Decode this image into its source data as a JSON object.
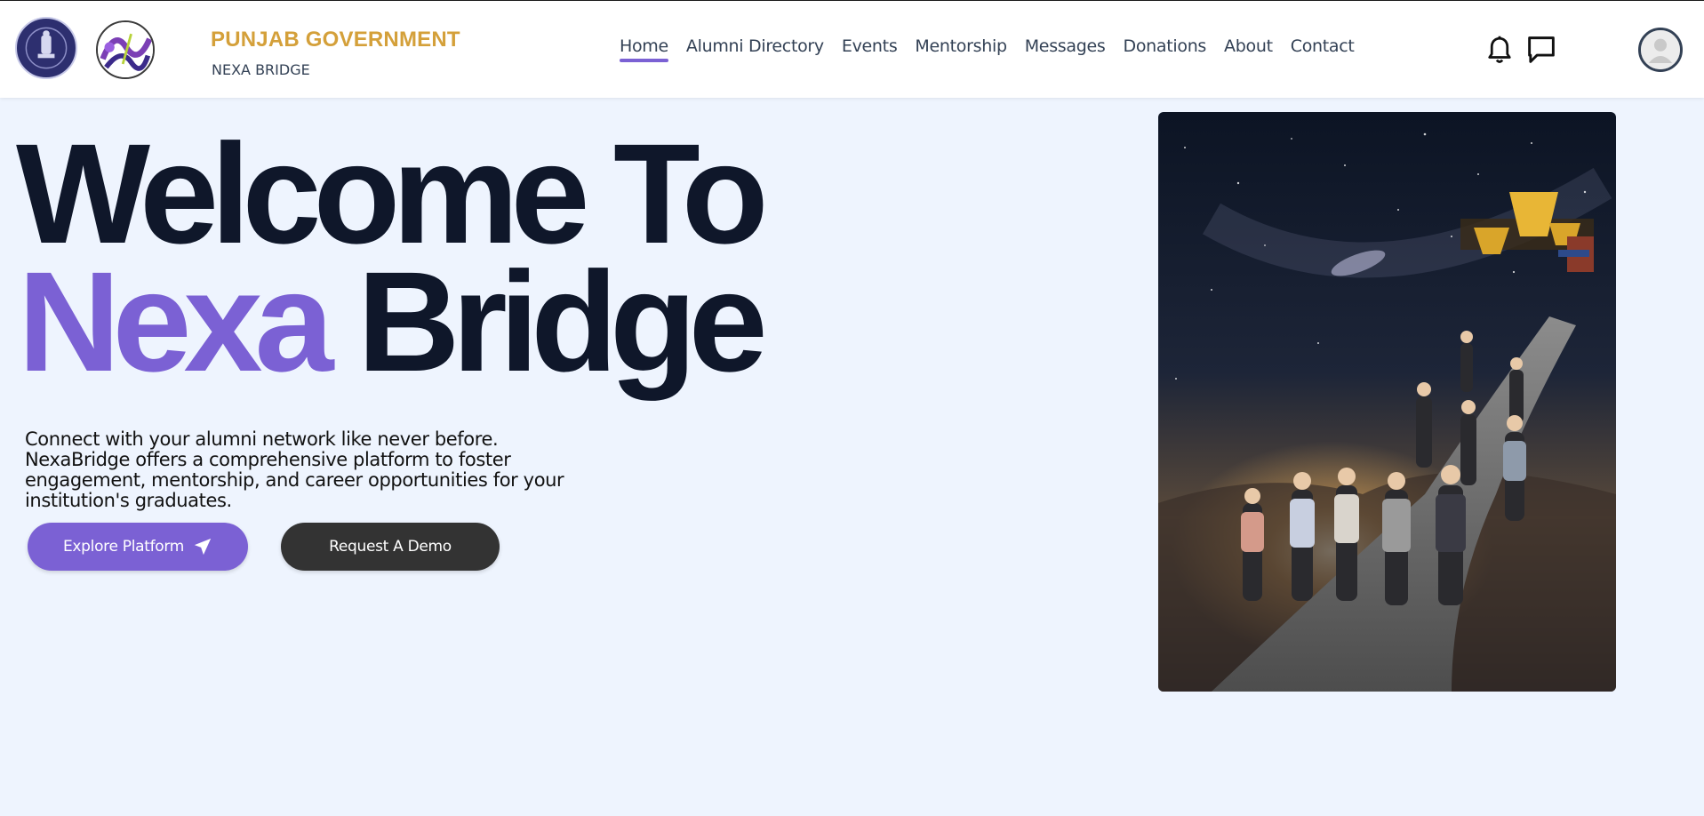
{
  "brand": {
    "title": "PUNJAB GOVERNMENT",
    "subtitle": "NEXA BRIDGE",
    "logos": [
      "emblem-logo",
      "nexa-logo"
    ]
  },
  "nav": {
    "items": [
      {
        "label": "Home",
        "active": true
      },
      {
        "label": "Alumni Directory",
        "active": false
      },
      {
        "label": "Events",
        "active": false
      },
      {
        "label": "Mentorship",
        "active": false
      },
      {
        "label": "Messages",
        "active": false
      },
      {
        "label": "Donations",
        "active": false
      },
      {
        "label": "About",
        "active": false
      },
      {
        "label": "Contact",
        "active": false
      }
    ],
    "icons": [
      "bell-icon",
      "chat-icon",
      "avatar"
    ]
  },
  "hero": {
    "line1": "Welcome To",
    "line2_accent": "Nexa",
    "line2_rest": "Bridge",
    "description": "Connect with your alumni network like never before. NexaBridge offers a comprehensive platform to foster engagement, mentorship, and career opportunities for your institution's graduates.",
    "primary_button": "Explore Platform",
    "secondary_button": "Request A Demo"
  },
  "colors": {
    "accent": "#7b61d4",
    "brand_gold": "#d4a03a",
    "heading": "#0f172a",
    "background": "#eef4fe",
    "secondary_button": "#333333"
  }
}
